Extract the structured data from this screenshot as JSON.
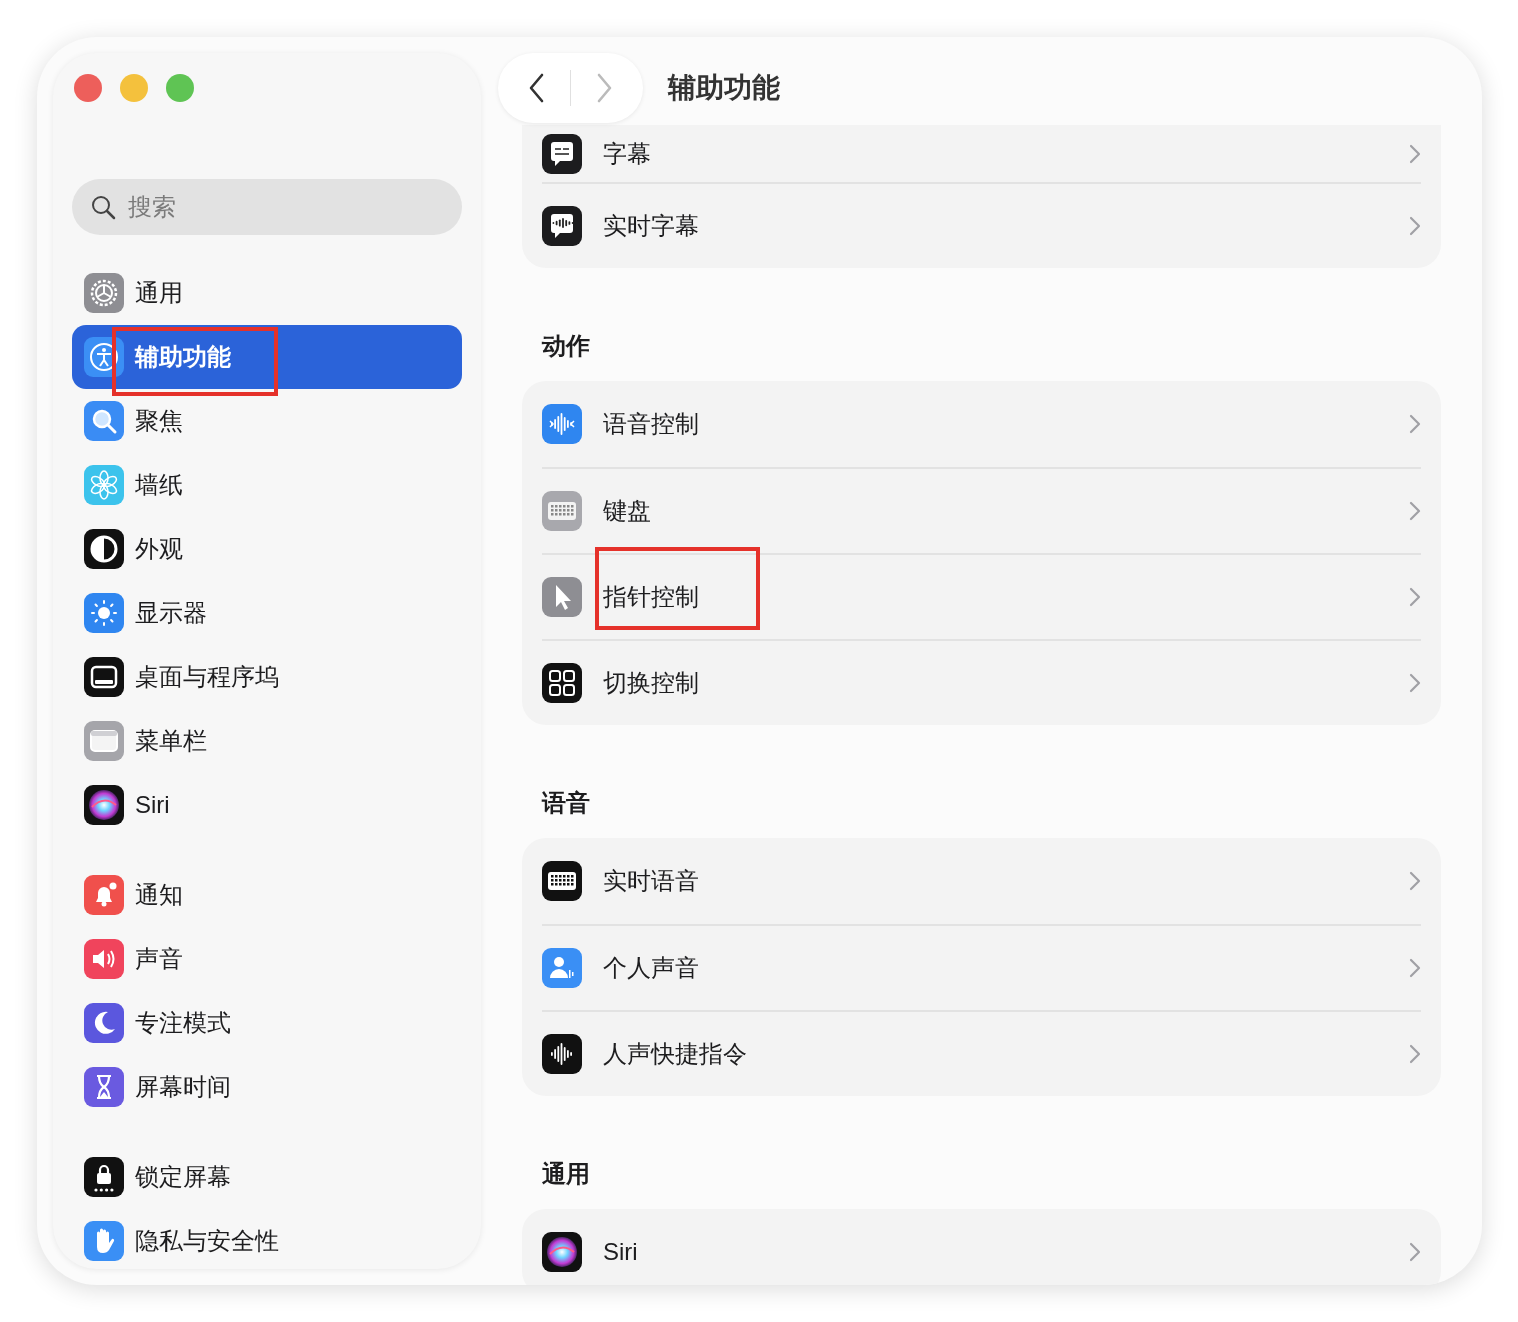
{
  "window": {
    "controls": [
      {
        "kind": "close"
      },
      {
        "kind": "minimize"
      },
      {
        "kind": "zoom"
      }
    ]
  },
  "sidebar": {
    "search": {
      "placeholder": "搜索"
    },
    "groups": [
      [
        {
          "label": "通用",
          "selected": false,
          "highlighted": false
        },
        {
          "label": "辅助功能",
          "selected": true,
          "highlighted": true
        },
        {
          "label": "聚焦",
          "selected": false,
          "highlighted": false
        },
        {
          "label": "墙纸",
          "selected": false,
          "highlighted": false
        },
        {
          "label": "外观",
          "selected": false,
          "highlighted": false
        },
        {
          "label": "显示器",
          "selected": false,
          "highlighted": false
        },
        {
          "label": "桌面与程序坞",
          "selected": false,
          "highlighted": false
        },
        {
          "label": "菜单栏",
          "selected": false,
          "highlighted": false
        },
        {
          "label": "Siri",
          "selected": false,
          "highlighted": false
        }
      ],
      [
        {
          "label": "通知",
          "selected": false,
          "highlighted": false
        },
        {
          "label": "声音",
          "selected": false,
          "highlighted": false
        },
        {
          "label": "专注模式",
          "selected": false,
          "highlighted": false
        },
        {
          "label": "屏幕时间",
          "selected": false,
          "highlighted": false
        }
      ],
      [
        {
          "label": "锁定屏幕",
          "selected": false,
          "highlighted": false
        },
        {
          "label": "隐私与安全性",
          "selected": false,
          "highlighted": false
        }
      ]
    ]
  },
  "toolbar": {
    "back": {
      "disabled": false
    },
    "forward": {
      "disabled": true
    },
    "title": "辅助功能"
  },
  "sections": [
    {
      "rows": [
        {
          "label": "字幕",
          "highlighted": false
        },
        {
          "label": "实时字幕",
          "highlighted": false
        }
      ]
    },
    {
      "heading": "动作",
      "rows": [
        {
          "label": "语音控制",
          "highlighted": false
        },
        {
          "label": "键盘",
          "highlighted": false
        },
        {
          "label": "指针控制",
          "highlighted": true
        },
        {
          "label": "切换控制",
          "highlighted": false
        }
      ]
    },
    {
      "heading": "语音",
      "rows": [
        {
          "label": "实时语音",
          "highlighted": false
        },
        {
          "label": "个人声音",
          "highlighted": false
        },
        {
          "label": "人声快捷指令",
          "highlighted": false
        }
      ]
    },
    {
      "heading": "通用",
      "rows": [
        {
          "label": "Siri",
          "highlighted": false
        }
      ]
    }
  ]
}
